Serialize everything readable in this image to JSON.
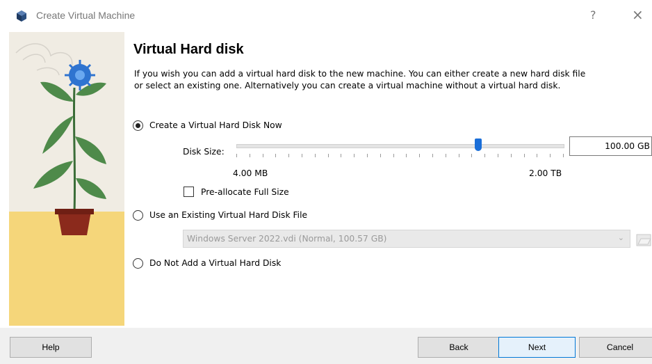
{
  "window": {
    "title": "Create Virtual Machine",
    "help_symbol": "?",
    "close_symbol": "×"
  },
  "page": {
    "heading": "Virtual Hard disk",
    "description": "If you wish you can add a virtual hard disk to the new machine. You can either create a new hard disk file or select an existing one. Alternatively you can create a virtual machine without a virtual hard disk."
  },
  "options": {
    "create_now": {
      "label": "Create a Virtual Hard Disk Now",
      "selected": true
    },
    "use_existing": {
      "label": "Use an Existing Virtual Hard Disk File",
      "selected": false
    },
    "do_not_add": {
      "label": "Do Not Add a Virtual Hard Disk",
      "selected": false
    }
  },
  "disk_size": {
    "label": "Disk Size:",
    "value": "100.00 GB",
    "min_label": "4.00 MB",
    "max_label": "2.00 TB",
    "slider_fraction": 0.74
  },
  "preallocate": {
    "label": "Pre-allocate Full Size",
    "checked": false
  },
  "existing_file": {
    "selected": "Windows Server 2022.vdi (Normal, 100.57 GB)"
  },
  "buttons": {
    "help": "Help",
    "back": "Back",
    "next": "Next",
    "cancel": "Cancel"
  },
  "colors": {
    "accent": "#1a6ed8",
    "footer_bg": "#f0f0f0",
    "default_button_border": "#0078d7"
  }
}
